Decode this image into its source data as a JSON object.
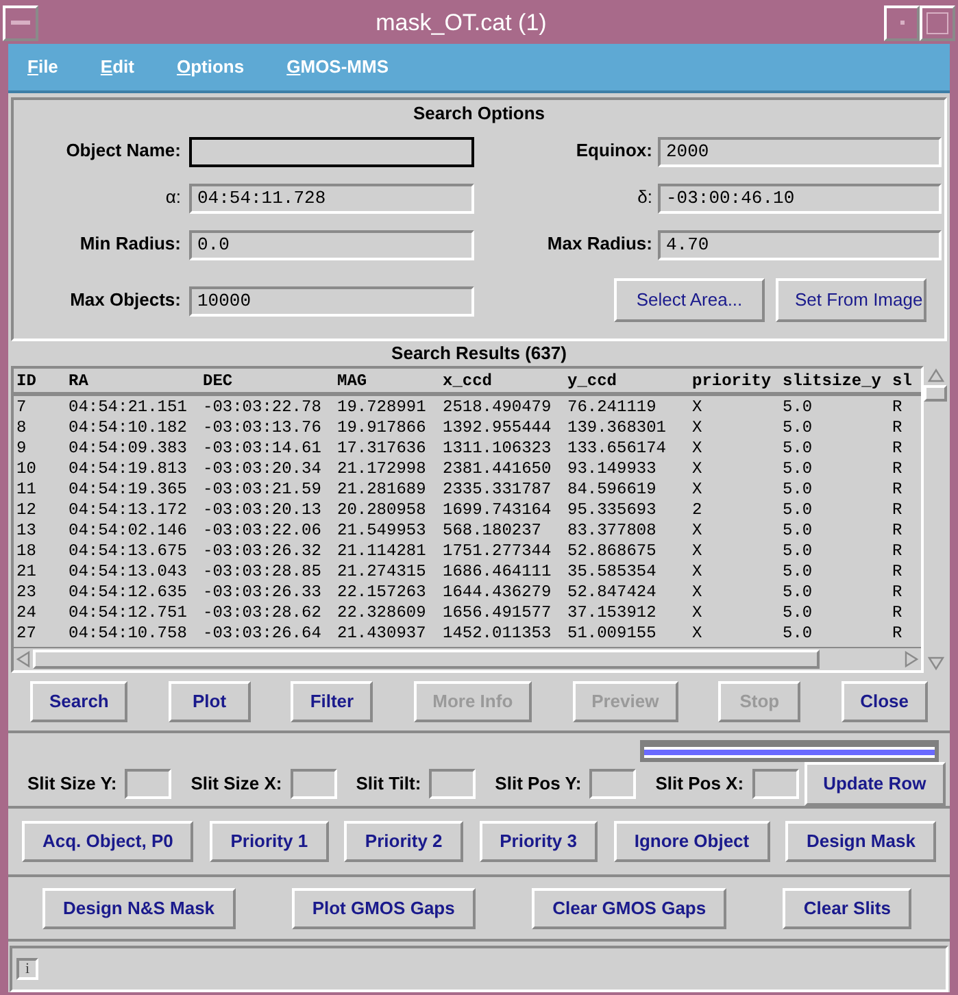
{
  "window": {
    "title": "mask_OT.cat (1)"
  },
  "menu": [
    {
      "parts": [
        {
          "text": "F",
          "underlined": true
        },
        {
          "text": "ile",
          "underlined": false
        }
      ]
    },
    {
      "parts": [
        {
          "text": "E",
          "underlined": true
        },
        {
          "text": "dit",
          "underlined": false
        }
      ]
    },
    {
      "parts": [
        {
          "text": "O",
          "underlined": true
        },
        {
          "text": "ptions",
          "underlined": false
        }
      ]
    },
    {
      "parts": [
        {
          "text": "G",
          "underlined": true
        },
        {
          "text": "MOS-MMS",
          "underlined": false
        }
      ]
    }
  ],
  "search_options": {
    "title": "Search Options",
    "fields": [
      {
        "label": "Object Name:",
        "focused": true
      },
      {
        "label": "Equinox:",
        "value": "2000",
        "focused": false
      },
      {
        "label": "α:",
        "value": "04:54:11.728",
        "focused": false
      },
      {
        "label": "δ:",
        "value": "-03:00:46.10",
        "focused": false
      },
      {
        "label": "Min Radius:",
        "value": "0.0",
        "focused": false
      },
      {
        "label": "Max Radius:",
        "value": "4.70",
        "focused": false
      },
      {
        "label": "Max Objects:",
        "value": "10000",
        "focused": false
      }
    ],
    "buttons": [
      "Select Area...",
      "Set From Image"
    ]
  },
  "results": {
    "title": "Search Results (637)",
    "columns": [
      "ID",
      "RA",
      "DEC",
      "MAG",
      "x_ccd",
      "y_ccd",
      "priority",
      "slitsize_y",
      "sl"
    ],
    "rows": [
      [
        "7",
        "04:54:21.151",
        "-03:03:22.78",
        "19.728991",
        "2518.490479",
        "76.241119",
        "X",
        "5.0",
        "R"
      ],
      [
        "8",
        "04:54:10.182",
        "-03:03:13.76",
        "19.917866",
        "1392.955444",
        "139.368301",
        "X",
        "5.0",
        "R"
      ],
      [
        "9",
        "04:54:09.383",
        "-03:03:14.61",
        "17.317636",
        "1311.106323",
        "133.656174",
        "X",
        "5.0",
        "R"
      ],
      [
        "10",
        "04:54:19.813",
        "-03:03:20.34",
        "21.172998",
        "2381.441650",
        "93.149933",
        "X",
        "5.0",
        "R"
      ],
      [
        "11",
        "04:54:19.365",
        "-03:03:21.59",
        "21.281689",
        "2335.331787",
        "84.596619",
        "X",
        "5.0",
        "R"
      ],
      [
        "12",
        "04:54:13.172",
        "-03:03:20.13",
        "20.280958",
        "1699.743164",
        "95.335693",
        "2",
        "5.0",
        "R"
      ],
      [
        "13",
        "04:54:02.146",
        "-03:03:22.06",
        "21.549953",
        "568.180237",
        "83.377808",
        "X",
        "5.0",
        "R"
      ],
      [
        "18",
        "04:54:13.675",
        "-03:03:26.32",
        "21.114281",
        "1751.277344",
        "52.868675",
        "X",
        "5.0",
        "R"
      ],
      [
        "21",
        "04:54:13.043",
        "-03:03:28.85",
        "21.274315",
        "1686.464111",
        "35.585354",
        "X",
        "5.0",
        "R"
      ],
      [
        "23",
        "04:54:12.635",
        "-03:03:26.33",
        "22.157263",
        "1644.436279",
        "52.847424",
        "X",
        "5.0",
        "R"
      ],
      [
        "24",
        "04:54:12.751",
        "-03:03:28.62",
        "22.328609",
        "1656.491577",
        "37.153912",
        "X",
        "5.0",
        "R"
      ],
      [
        "27",
        "04:54:10.758",
        "-03:03:26.64",
        "21.430937",
        "1452.011353",
        "51.009155",
        "X",
        "5.0",
        "R"
      ]
    ]
  },
  "actions": [
    {
      "label": "Search",
      "disabled": false
    },
    {
      "label": "Plot",
      "disabled": false
    },
    {
      "label": "Filter",
      "disabled": false
    },
    {
      "label": "More Info",
      "disabled": true
    },
    {
      "label": "Preview",
      "disabled": true
    },
    {
      "label": "Stop",
      "disabled": true
    },
    {
      "label": "Close",
      "disabled": false
    }
  ],
  "progress": {
    "level": 1
  },
  "slit_fields": [
    {
      "label": "Slit Size Y:"
    },
    {
      "label": "Slit Size X:"
    },
    {
      "label": "Slit Tilt:"
    },
    {
      "label": "Slit Pos Y:"
    },
    {
      "label": "Slit Pos X:"
    }
  ],
  "update_button": "Update Row",
  "priority_buttons": [
    "Acq. Object, P0",
    "Priority 1",
    "Priority 2",
    "Priority 3",
    "Ignore Object",
    "Design Mask"
  ],
  "mask_buttons": [
    "Design N&S Mask",
    "Plot GMOS Gaps",
    "Clear GMOS Gaps",
    "Clear Slits"
  ],
  "status_bar": {
    "icon_text": "i"
  }
}
